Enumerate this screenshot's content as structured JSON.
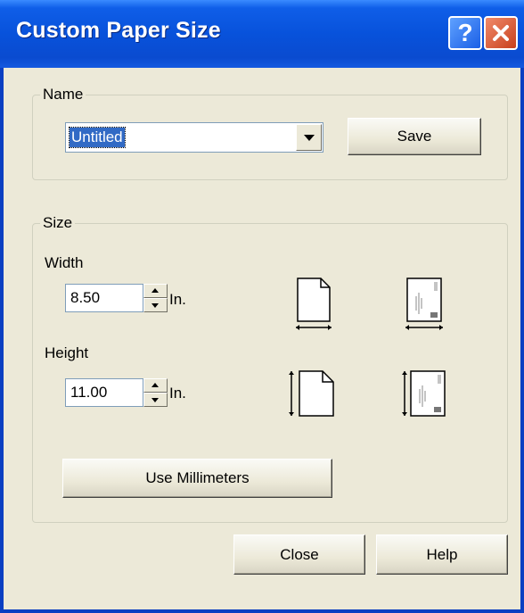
{
  "window": {
    "title": "Custom Paper Size"
  },
  "titlebar": {
    "help_glyph": "?",
    "help_icon": "help-question-icon",
    "close_icon": "close-x-icon"
  },
  "name_group": {
    "legend": "Name",
    "combo": {
      "value": "Untitled"
    },
    "save_label": "Save"
  },
  "size_group": {
    "legend": "Size",
    "width": {
      "label": "Width",
      "value": "8.50",
      "unit": "In."
    },
    "height": {
      "label": "Height",
      "value": "11.00",
      "unit": "In."
    },
    "units_button_label": "Use Millimeters",
    "icons": [
      "paper-width-icon",
      "envelope-width-icon",
      "paper-height-icon",
      "envelope-height-icon"
    ]
  },
  "footer": {
    "close_label": "Close",
    "help_label": "Help"
  }
}
